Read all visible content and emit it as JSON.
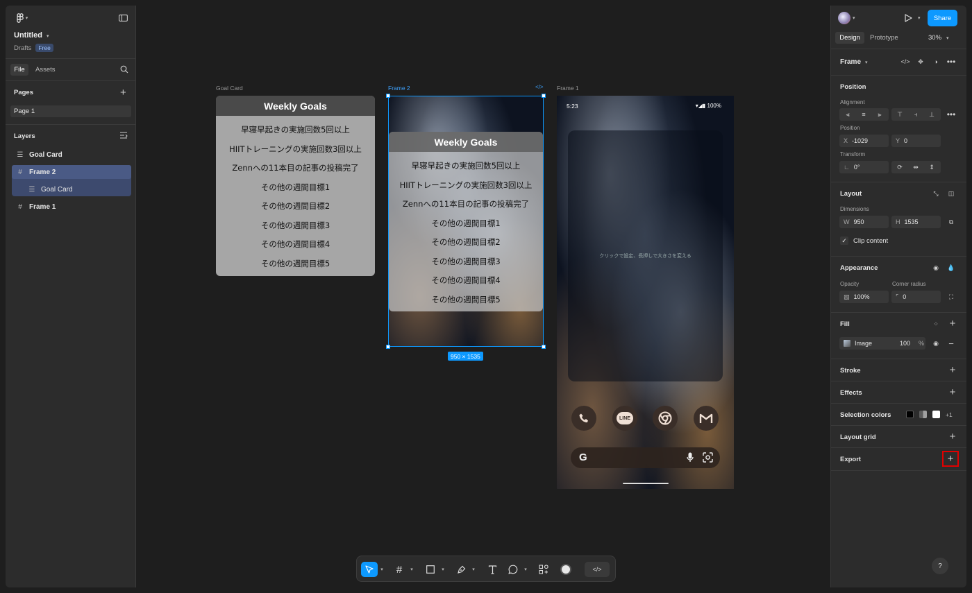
{
  "file": {
    "title": "Untitled",
    "location": "Drafts",
    "plan_badge": "Free"
  },
  "left_tabs": {
    "file": "File",
    "assets": "Assets"
  },
  "pages": {
    "header": "Pages",
    "items": [
      "Page 1"
    ]
  },
  "layers": {
    "header": "Layers",
    "items": [
      {
        "label": "Goal Card",
        "icon": "text-component-icon"
      },
      {
        "label": "Frame 2",
        "icon": "frame-hash-icon"
      },
      {
        "label": "Goal Card",
        "icon": "text-component-icon"
      },
      {
        "label": "Frame 1",
        "icon": "frame-hash-icon"
      }
    ]
  },
  "canvas": {
    "goal_card_label": "Goal Card",
    "frame2_label": "Frame 2",
    "frame1_label": "Frame 1",
    "selection_size": "950 × 1535",
    "card_title": "Weekly Goals",
    "goals": [
      "早寝早起きの実施回数5回以上",
      "HIITトレーニングの実施回数3回以上",
      "Zennへの11本目の記事の投稿完了",
      "その他の週間目標1",
      "その他の週間目標2",
      "その他の週間目標3",
      "その他の週間目標4",
      "その他の週間目標5"
    ],
    "phone": {
      "time": "5:23",
      "battery": "100%",
      "widget_hint": "クリックで設定、長押しで大きさを変える",
      "apps": [
        "phone-icon",
        "line-icon",
        "chrome-icon",
        "gmail-icon"
      ],
      "line_label": "LINE",
      "search_logo": "G"
    }
  },
  "right": {
    "share": "Share",
    "tabs": {
      "design": "Design",
      "prototype": "Prototype"
    },
    "zoom": "30%",
    "selection_type": "Frame",
    "position": {
      "header": "Position",
      "alignment_label": "Alignment",
      "position_label": "Position",
      "x_key": "X",
      "x": "-1029",
      "y_key": "Y",
      "y": "0",
      "transform_label": "Transform",
      "rotation": "0°"
    },
    "layout": {
      "header": "Layout",
      "dimensions_label": "Dimensions",
      "w_key": "W",
      "w": "950",
      "h_key": "H",
      "h": "1535",
      "clip": "Clip content"
    },
    "appearance": {
      "header": "Appearance",
      "opacity_label": "Opacity",
      "opacity": "100%",
      "radius_label": "Corner radius",
      "radius": "0"
    },
    "fill": {
      "header": "Fill",
      "type": "Image",
      "value": "100",
      "unit": "%"
    },
    "stroke": "Stroke",
    "effects": "Effects",
    "selection_colors": {
      "header": "Selection colors",
      "more": "+1",
      "colors": [
        "#000000",
        "#8a8a8a",
        "#ffffff"
      ]
    },
    "layout_grid": "Layout grid",
    "export": "Export",
    "help": "?"
  },
  "colors": {
    "accent": "#0d99ff",
    "export_highlight": "#e00000",
    "selected_layer": "#4a5a85"
  }
}
